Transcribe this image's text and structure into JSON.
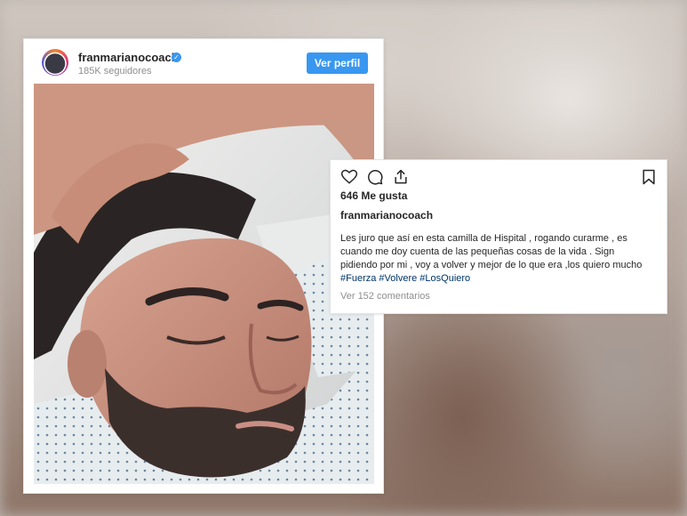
{
  "post": {
    "username": "franmarianocoach",
    "followers": "185K seguidores",
    "profile_button": "Ver perfil",
    "likes": "646 Me gusta",
    "caption_user": "franmarianocoach",
    "caption_text": "Les juro que así en esta camilla de Hispital , rogando curarme , es cuando me doy cuenta de las pequeñas cosas de la vida . Sign pidiendo por mi , voy a volver y mejor de lo que era ,los quiero mucho",
    "hashtags": [
      "#Fuerza",
      "#Volvere",
      "#LosQuiero"
    ],
    "view_comments": "Ver 152 comentarios"
  },
  "icons": {
    "verified": "verified-badge-icon",
    "like": "heart-icon",
    "comment": "comment-icon",
    "share": "share-icon",
    "save": "bookmark-icon"
  },
  "colors": {
    "accent": "#3897f0",
    "hashtag": "#003569",
    "muted": "#8e8e8e",
    "text": "#262626"
  }
}
